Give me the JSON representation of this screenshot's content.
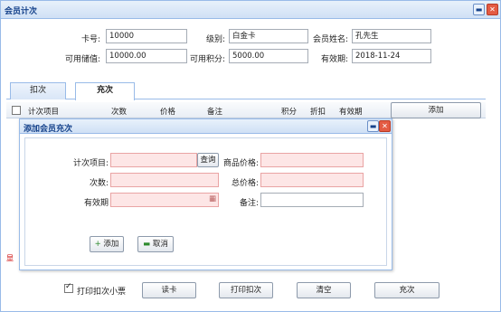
{
  "window": {
    "title": "会员计次"
  },
  "info": {
    "card_label": "卡号:",
    "card_value": "10000",
    "level_label": "级别:",
    "level_value": "白金卡",
    "name_label": "会员姓名:",
    "name_value": "孔先生",
    "balance_label": "可用储值:",
    "balance_value": "10000.00",
    "points_label": "可用积分:",
    "points_value": "5000.00",
    "expiry_label": "有效期:",
    "expiry_value": "2018-11-24"
  },
  "tabs": [
    {
      "label": "扣次"
    },
    {
      "label": "充次"
    }
  ],
  "grid": {
    "columns": [
      "计次项目",
      "次数",
      "价格",
      "备注",
      "积分",
      "折扣",
      "有效期"
    ],
    "add_label": "添加"
  },
  "dialog": {
    "title": "添加会员充次",
    "item_label": "计次项目:",
    "query_label": "查询",
    "goods_price_label": "商品价格:",
    "count_label": "次数:",
    "total_label": "总价格:",
    "expiry_label": "有效期",
    "remark_label": "备注:",
    "add_label": "添加",
    "cancel_label": "取消"
  },
  "left_red_text": "显",
  "footer": {
    "print_label": "打印扣次小票",
    "read_card": "读卡",
    "print_deduct": "打印扣次",
    "clear": "清空",
    "recharge": "充次"
  }
}
